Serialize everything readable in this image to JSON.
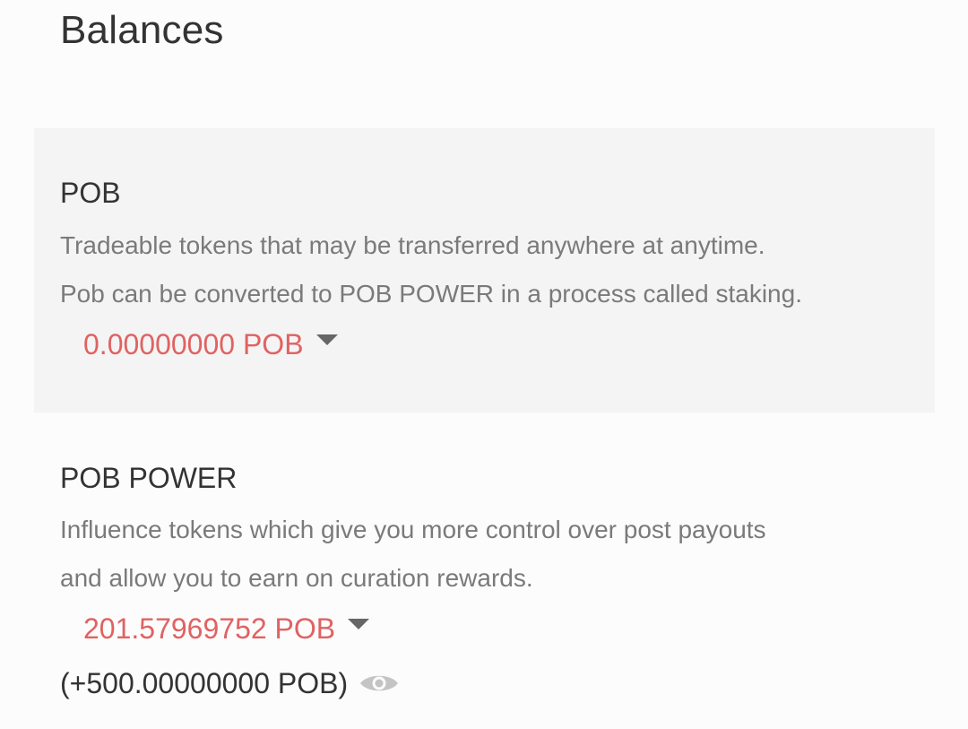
{
  "page": {
    "title": "Balances"
  },
  "pob": {
    "name": "POB",
    "description_line1": "Tradeable tokens that may be transferred anywhere at anytime.",
    "description_line2": "Pob can be converted to POB POWER in a process called staking.",
    "amount": "0.00000000 POB",
    "amount_icon": "caret-down-icon"
  },
  "pob_power": {
    "name": "POB POWER",
    "description_line1": "Influence tokens which give you more control over post payouts",
    "description_line2": "and allow you to earn on curation rewards.",
    "amount": "201.57969752 POB",
    "amount_icon": "caret-down-icon",
    "delegated": "(+500.00000000 POB)",
    "delegated_icon": "eye-icon"
  },
  "colors": {
    "amount_red": "#e06262",
    "panel_bg": "#f4f4f4",
    "page_bg": "#fcfcfc",
    "muted_text": "#7a7a7a",
    "caret": "#666666",
    "eye_icon": "#c4c4c4"
  }
}
